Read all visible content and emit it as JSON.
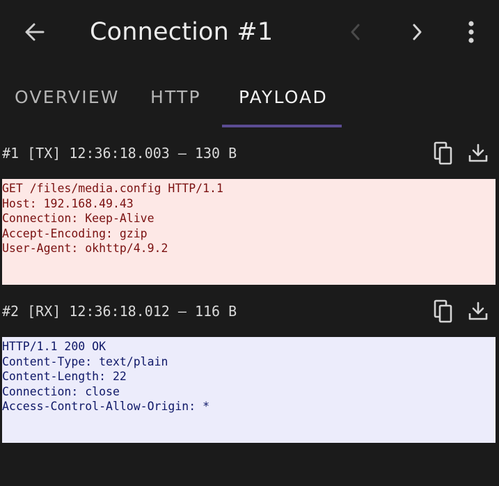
{
  "appbar": {
    "title": "Connection #1",
    "icons": {
      "back": "arrow-back-icon",
      "prev": "chevron-left-icon",
      "next": "chevron-right-icon",
      "menu": "more-vert-icon"
    }
  },
  "tabs": [
    {
      "label": "OVERVIEW",
      "active": false
    },
    {
      "label": "HTTP",
      "active": false
    },
    {
      "label": "PAYLOAD",
      "active": true
    }
  ],
  "segments": [
    {
      "label": "#1 [TX] 12:36:18.003 — 130 B",
      "lines": [
        "GET /files/media.config HTTP/1.1",
        "Host: 192.168.49.43",
        "Connection: Keep-Alive",
        "Accept-Encoding: gzip",
        "User-Agent: okhttp/4.9.2"
      ]
    },
    {
      "label": "#2 [RX] 12:36:18.012 — 116 B",
      "lines": [
        "HTTP/1.1 200 OK",
        "Content-Type: text/plain",
        "Content-Length: 22",
        "Connection: close",
        "Access-Control-Allow-Origin: *"
      ]
    }
  ],
  "colors": {
    "background": "#1b1b1b",
    "tab_indicator": "#5b4c92",
    "tx_background": "#fde8e6",
    "tx_text": "#7a1010",
    "rx_background": "#ececfb",
    "rx_text": "#0f1868"
  }
}
